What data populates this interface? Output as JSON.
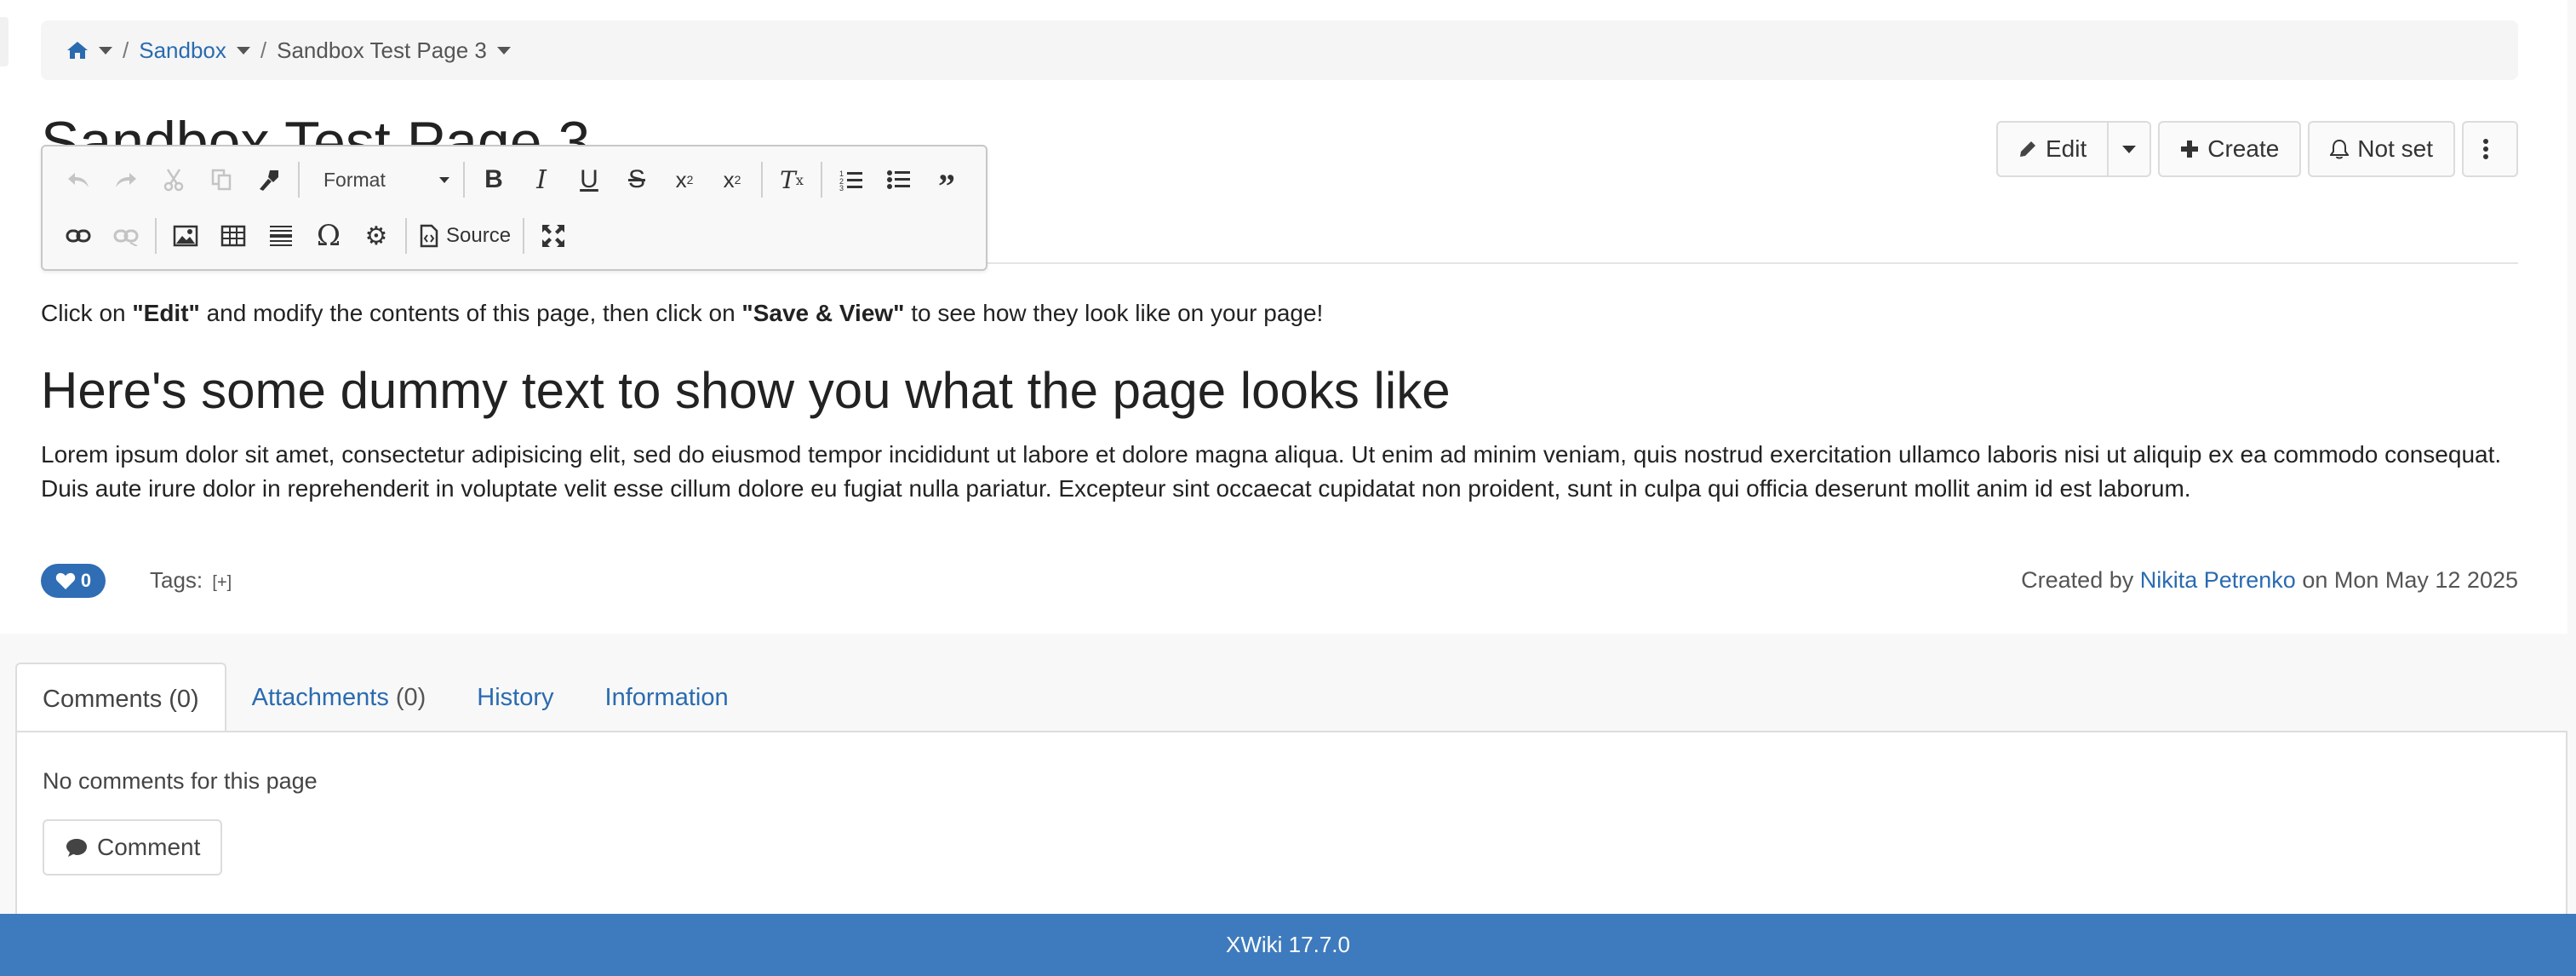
{
  "breadcrumb": {
    "space": "Sandbox",
    "page": "Sandbox Test Page 3",
    "separator": "/"
  },
  "page": {
    "title": "Sandbox Test Page 3"
  },
  "toolbar": {
    "format_label": "Format",
    "source_label": "Source",
    "row1_icons": [
      "undo-icon",
      "redo-icon",
      "cut-icon",
      "copy-icon",
      "copy-formatting-icon",
      "format-combo",
      "bold-icon",
      "italic-icon",
      "underline-icon",
      "strikethrough-icon",
      "subscript-icon",
      "superscript-icon",
      "remove-format-icon",
      "numbered-list-icon",
      "bulleted-list-icon",
      "blockquote-icon"
    ],
    "row2_icons": [
      "link-icon",
      "unlink-icon",
      "image-icon",
      "table-icon",
      "horizontal-line-icon",
      "special-char-icon",
      "macro-gear-icon",
      "source-icon",
      "maximize-icon"
    ]
  },
  "actions": {
    "edit": "Edit",
    "create": "Create",
    "notifications": "Not set"
  },
  "content": {
    "intro_before": "Click on ",
    "intro_edit": "\"Edit\"",
    "intro_middle": " and modify the contents of this page, then click on ",
    "intro_save": "\"Save & View\"",
    "intro_after": " to see how they look like on your page!",
    "heading": "Here's some dummy text to show you what the page looks like",
    "lorem": "Lorem ipsum dolor sit amet, consectetur adipisicing elit, sed do eiusmod tempor incididunt ut labore et dolore magna aliqua. Ut enim ad minim veniam, quis nostrud exercitation ullamco laboris nisi ut aliquip ex ea commodo consequat. Duis aute irure dolor in reprehenderit in voluptate velit esse cillum dolore eu fugiat nulla pariatur. Excepteur sint occaecat cupidatat non proident, sunt in culpa qui officia deserunt mollit anim id est laborum."
  },
  "meta": {
    "likes": "0",
    "tags_label": "Tags:",
    "tags_add": "[+]",
    "created_prefix": "Created by ",
    "author": "Nikita Petrenko",
    "created_suffix": " on Mon May 12 2025"
  },
  "tabs": [
    {
      "label": "Comments",
      "count": "(0)"
    },
    {
      "label": "Attachments",
      "count": "(0)"
    },
    {
      "label": "History",
      "count": ""
    },
    {
      "label": "Information",
      "count": ""
    }
  ],
  "comments": {
    "empty_text": "No comments for this page",
    "button": "Comment"
  },
  "footer": {
    "text": "XWiki 17.7.0"
  },
  "colors": {
    "link": "#2a6bb0",
    "footer_bg": "#3e7bbe",
    "like_bg": "#2f6db5"
  }
}
